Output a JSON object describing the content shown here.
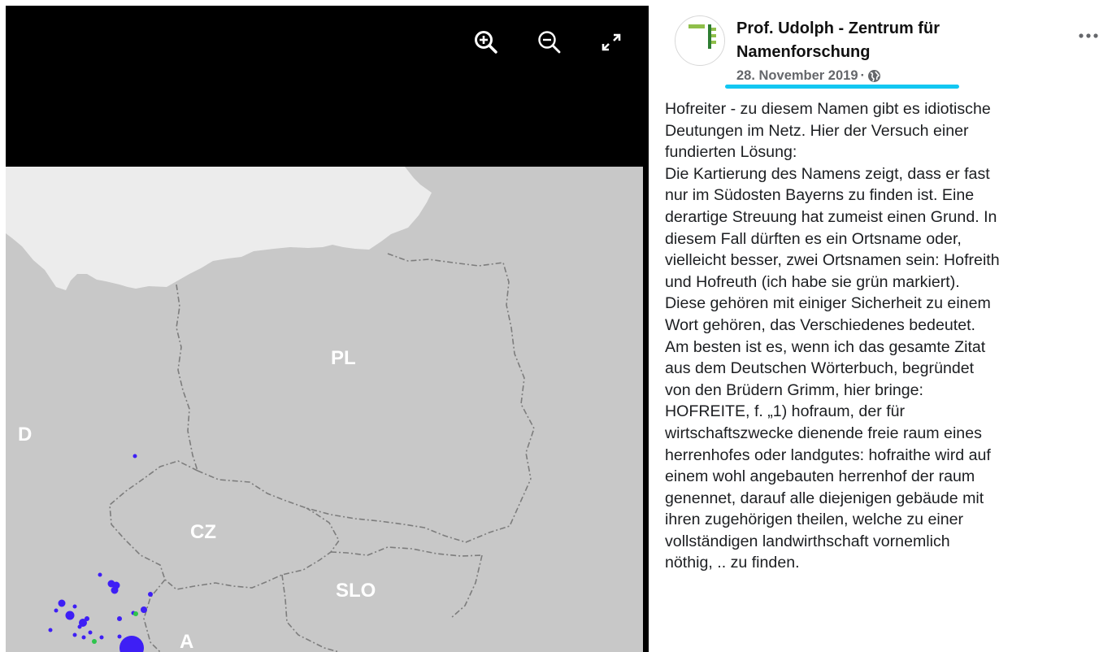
{
  "viewer": {
    "controls": {
      "zoom_in": "zoom-in-icon",
      "zoom_out": "zoom-out-icon",
      "fullscreen": "fullscreen-icon"
    },
    "map": {
      "labels": {
        "pl": "PL",
        "d": "D",
        "cz": "CZ",
        "slo": "SLO",
        "a": "A"
      },
      "colors": {
        "land": "#c8c8c8",
        "sea": "#ececec",
        "border": "#7d7d7d",
        "dots_blue": "#3e1ff5",
        "dots_green": "#2ec44c"
      }
    }
  },
  "post": {
    "author": "Prof. Udolph - Zentrum für Namenforschung",
    "date": "28. November 2019",
    "separator": "·",
    "privacy_icon": "globe-icon",
    "more_icon": "more-options-icon",
    "highlight_color": "#12c7f2",
    "lines": [
      "Hofreiter - zu diesem Namen gibt es idiotische",
      "Deutungen im Netz. Hier der Versuch einer",
      "fundierten Lösung:",
      "Die Kartierung des Namens zeigt, dass er fast",
      "nur im Südosten Bayerns zu finden ist. Eine",
      "derartige Streuung hat zumeist einen Grund. In",
      "diesem Fall dürften es ein Ortsname oder,",
      "vielleicht besser, zwei Ortsnamen sein: Hofreith",
      "und Hofreuth (ich habe sie grün markiert).",
      "Diese gehören mit einiger Sicherheit zu einem",
      "Wort gehören, das Verschiedenes bedeutet.",
      "Am besten ist es, wenn ich das gesamte Zitat",
      "aus dem Deutschen Wörterbuch, begründet",
      "von den Brüdern Grimm, hier bringe:",
      "HOFREITE, f. „1) hofraum, der für",
      "wirtschaftszwecke dienende freie raum eines",
      "herrenhofes oder landgutes: hofraithe wird auf",
      "einem wohl angebauten herrenhof der raum",
      "genennet, darauf alle diejenigen gebäude mit",
      "ihren zugehörigen theilen, welche zu einer",
      "vollständigen landwirthschaft vornemlich",
      "nöthig, .. zu finden."
    ]
  }
}
